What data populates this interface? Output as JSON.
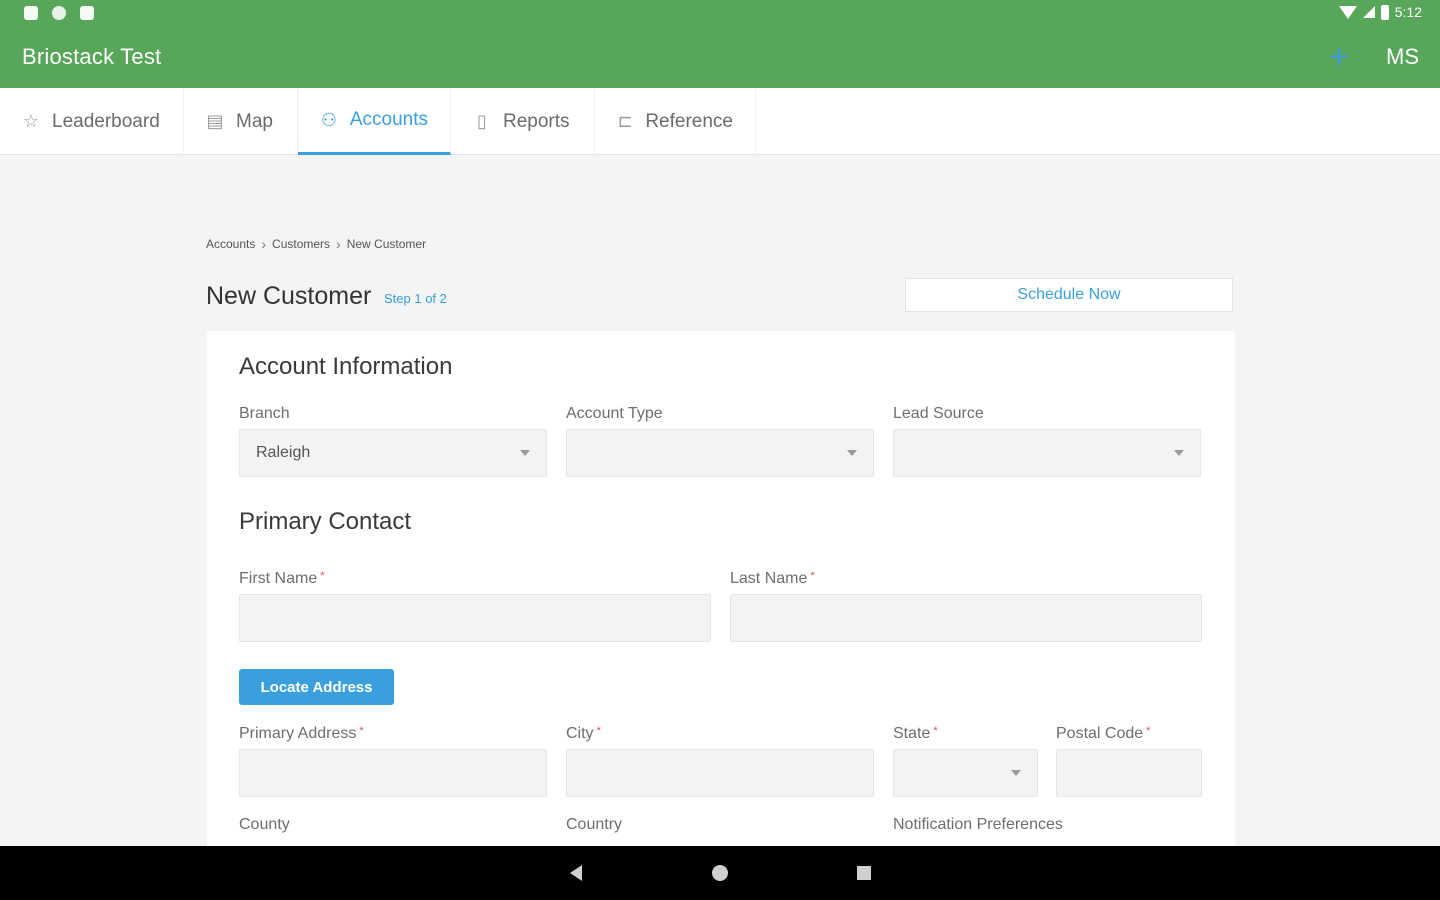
{
  "status_bar": {
    "time": "5:12"
  },
  "app": {
    "title": "Briostack Test",
    "add_label": "+",
    "user_initials": "MS"
  },
  "tabs": [
    {
      "label": "Leaderboard",
      "icon": "star-icon",
      "active": false
    },
    {
      "label": "Map",
      "icon": "map-icon",
      "active": false
    },
    {
      "label": "Accounts",
      "icon": "accounts-icon",
      "active": true
    },
    {
      "label": "Reports",
      "icon": "reports-icon",
      "active": false
    },
    {
      "label": "Reference",
      "icon": "folder-icon",
      "active": false
    }
  ],
  "breadcrumb": [
    "Accounts",
    "Customers",
    "New Customer"
  ],
  "page": {
    "title": "New Customer",
    "step": "Step 1 of 2",
    "schedule_label": "Schedule Now"
  },
  "account_info": {
    "title": "Account Information",
    "branch": {
      "label": "Branch",
      "value": "Raleigh"
    },
    "account_type": {
      "label": "Account Type",
      "value": ""
    },
    "lead_source": {
      "label": "Lead Source",
      "value": ""
    }
  },
  "primary_contact": {
    "title": "Primary Contact",
    "first_name": {
      "label": "First Name",
      "value": ""
    },
    "last_name": {
      "label": "Last Name",
      "value": ""
    },
    "locate_label": "Locate Address",
    "primary_address": {
      "label": "Primary Address",
      "value": ""
    },
    "city": {
      "label": "City",
      "value": ""
    },
    "state": {
      "label": "State",
      "value": ""
    },
    "postal_code": {
      "label": "Postal Code",
      "value": ""
    },
    "county": {
      "label": "County"
    },
    "country": {
      "label": "Country"
    },
    "notification": {
      "label": "Notification Preferences"
    }
  },
  "required_mark": "*",
  "colors": {
    "appbar": "#57a65a",
    "accent": "#3aa0dd",
    "required": "#e05050"
  }
}
